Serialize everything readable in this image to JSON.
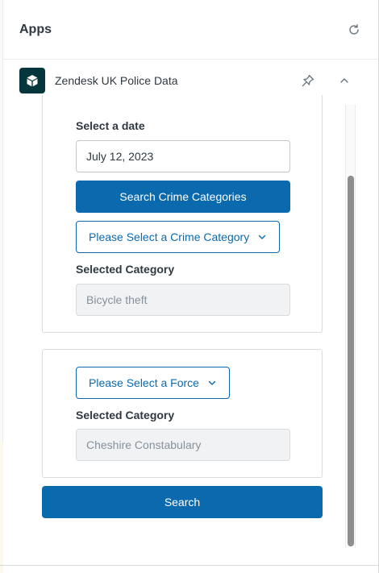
{
  "apps_panel": {
    "title": "Apps",
    "refresh_icon": "refresh-icon"
  },
  "app": {
    "name": "Zendesk UK Police Data",
    "logo_icon": "box-icon",
    "pin_icon": "pin-icon",
    "collapse_icon": "chevron-up-icon"
  },
  "crime_card": {
    "date_label": "Select a date",
    "date_value": "July 12, 2023",
    "search_categories_label": "Search Crime Categories",
    "category_dropdown_label": "Please Select a Crime Category",
    "selected_category_label": "Selected Category",
    "selected_category_value": "Bicycle theft"
  },
  "force_card": {
    "force_dropdown_label": "Please Select a Force",
    "selected_category_label": "Selected Category",
    "selected_category_value": "Cheshire Constabulary"
  },
  "search_button_label": "Search",
  "colors": {
    "primary": "#0b69ae",
    "logo_bg": "#03363d",
    "text": "#2f3941",
    "muted": "#87929d"
  }
}
